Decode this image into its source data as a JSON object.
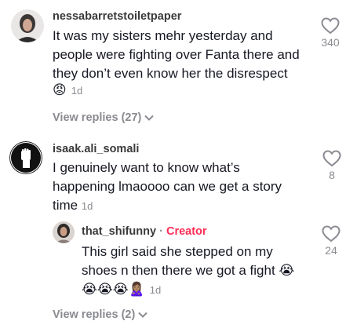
{
  "comments": [
    {
      "username": "nessabarretstoiletpaper",
      "lines": [
        "It was my sisters mehr yesterday and",
        "people were fighting over Fanta there and",
        "they don’t even know her the disrespect"
      ],
      "reaction": "😡",
      "time": "1d",
      "likes": "340",
      "view_replies": "View replies (27)"
    },
    {
      "username": "isaak.ali_somali",
      "lines": [
        "I genuinely want to know what’s",
        "happening lmaoooo can we get a story"
      ],
      "last_line": "time",
      "time": "1d",
      "likes": "8"
    }
  ],
  "reply": {
    "username": "that_shifunny",
    "separator": "·",
    "badge": "Creator",
    "lines": [
      "This girl said she stepped on my"
    ],
    "last_line": "shoes n then there we got a fight",
    "last_emoji": "😭",
    "emojis": "😭😭😭🙎🏽‍♀️",
    "time": "1d",
    "likes": "24"
  },
  "footer": {
    "view_replies": "View replies (2)"
  },
  "colors": {
    "accent": "#fe2c55",
    "muted": "#8a8b91",
    "text": "#161823"
  }
}
